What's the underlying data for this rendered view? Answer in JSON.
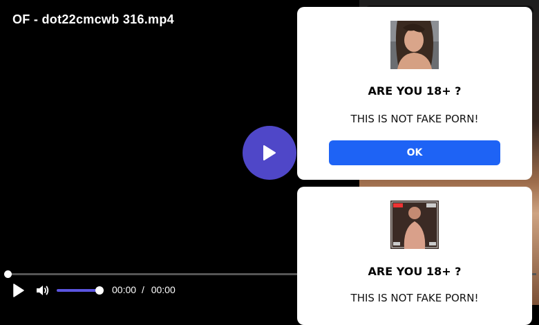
{
  "video": {
    "title": "OF - dot22cmcwb 316.mp4",
    "current_time": "00:00",
    "separator": "/",
    "duration": "00:00",
    "progress": 0,
    "volume": 1.0
  },
  "icons": {
    "big_play": "play-icon",
    "play": "play-icon",
    "volume": "volume-icon"
  },
  "colors": {
    "accent": "#4f47c8",
    "volume_bar": "#5b55e0",
    "ok_button": "#1e63f5"
  },
  "modals": [
    {
      "heading": "ARE YOU 18+ ?",
      "message": "THIS IS NOT FAKE PORN!",
      "button_label": "OK"
    },
    {
      "heading": "ARE YOU 18+ ?",
      "message": "THIS IS NOT FAKE PORN!"
    }
  ]
}
